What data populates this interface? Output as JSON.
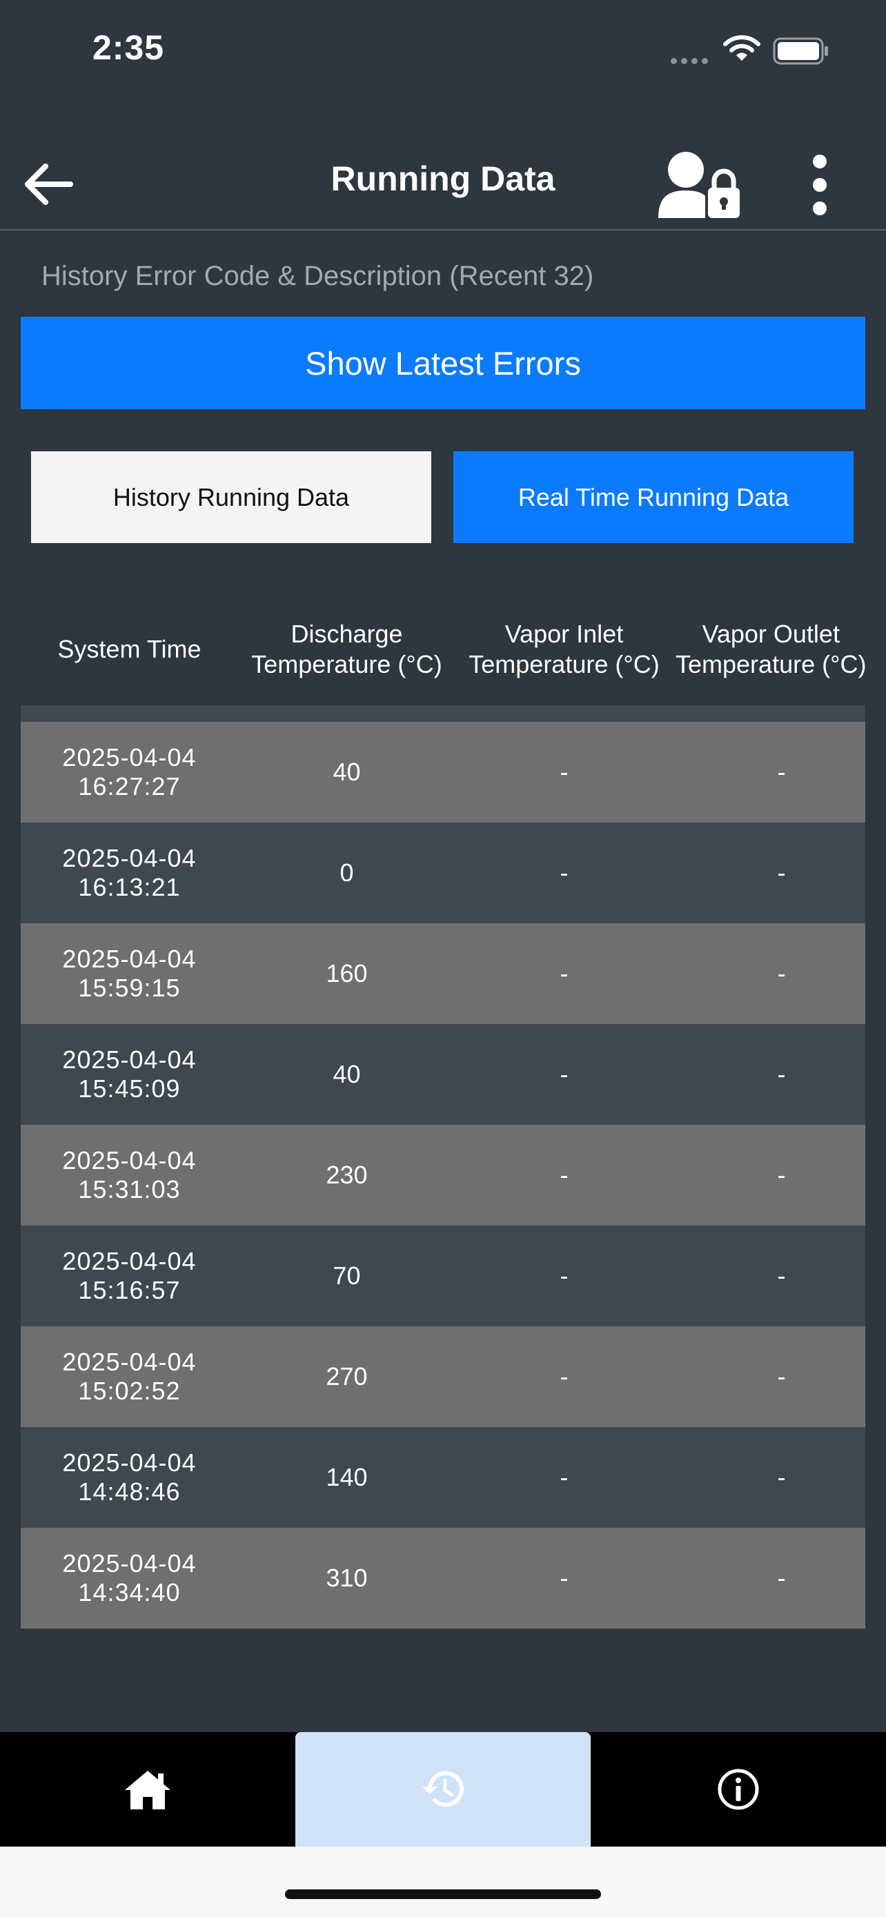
{
  "status_bar": {
    "time": "2:35"
  },
  "header": {
    "title": "Running Data"
  },
  "errors": {
    "section_title": "History Error Code & Description (Recent 32)",
    "show_latest_label": "Show Latest Errors"
  },
  "tabs": {
    "history_label": "History Running Data",
    "realtime_label": "Real Time Running Data"
  },
  "table": {
    "columns": [
      "System Time",
      "Discharge\nTemperature (°C)",
      "Vapor Inlet\nTemperature (°C)",
      "Vapor Outlet\nTemperature (°C)"
    ],
    "rows": [
      {
        "time": "2025-04-04\n16:27:27",
        "discharge": "40",
        "vapor_inlet": "-",
        "vapor_outlet": "-"
      },
      {
        "time": "2025-04-04\n16:13:21",
        "discharge": "0",
        "vapor_inlet": "-",
        "vapor_outlet": "-"
      },
      {
        "time": "2025-04-04\n15:59:15",
        "discharge": "160",
        "vapor_inlet": "-",
        "vapor_outlet": "-"
      },
      {
        "time": "2025-04-04\n15:45:09",
        "discharge": "40",
        "vapor_inlet": "-",
        "vapor_outlet": "-"
      },
      {
        "time": "2025-04-04\n15:31:03",
        "discharge": "230",
        "vapor_inlet": "-",
        "vapor_outlet": "-"
      },
      {
        "time": "2025-04-04\n15:16:57",
        "discharge": "70",
        "vapor_inlet": "-",
        "vapor_outlet": "-"
      },
      {
        "time": "2025-04-04\n15:02:52",
        "discharge": "270",
        "vapor_inlet": "-",
        "vapor_outlet": "-"
      },
      {
        "time": "2025-04-04\n14:48:46",
        "discharge": "140",
        "vapor_inlet": "-",
        "vapor_outlet": "-"
      },
      {
        "time": "2025-04-04\n14:34:40",
        "discharge": "310",
        "vapor_inlet": "-",
        "vapor_outlet": "-"
      }
    ]
  },
  "tabbar": {
    "items": [
      {
        "icon": "home-icon",
        "selected": false
      },
      {
        "icon": "history-icon",
        "selected": true
      },
      {
        "icon": "info-icon",
        "selected": false
      }
    ]
  },
  "colors": {
    "background": "#2e363e",
    "accent": "#0a7bff",
    "row_light": "#6f6f6f",
    "row_dark": "#3f474f",
    "selected_tab": "#cfe2f8"
  }
}
